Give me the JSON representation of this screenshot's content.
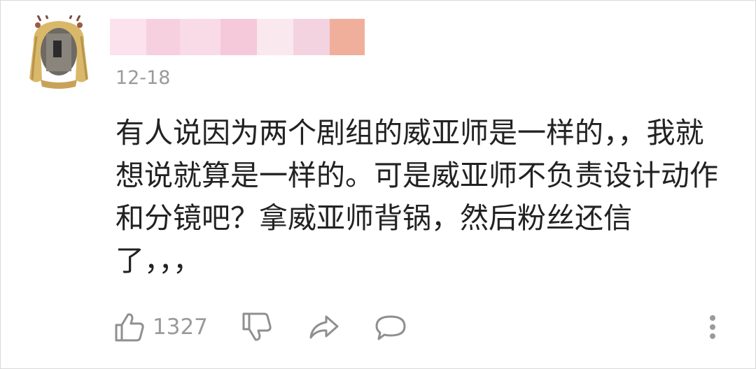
{
  "comment": {
    "date": "12-18",
    "lines": [
      "有人说因为两个剧组的威亚师是一样的，，我就",
      "想说就算是一样的。可是威亚师不负责设计动作",
      "和分镜吧？拿威亚师背锅，然后粉丝还信",
      "了，，，"
    ]
  },
  "actions": {
    "like_count": "1327",
    "icons": [
      "thumbs-up-icon",
      "thumbs-down-icon",
      "share-icon",
      "reply-icon",
      "more-icon"
    ]
  },
  "colors": {
    "text": "#222222",
    "muted": "#9a9a9a",
    "icon": "#8f8f8f",
    "username_blur": [
      "#f9dbe7",
      "#f5c9d9",
      "#fae8ef",
      "#eed7d8",
      "#f0af9b"
    ]
  }
}
